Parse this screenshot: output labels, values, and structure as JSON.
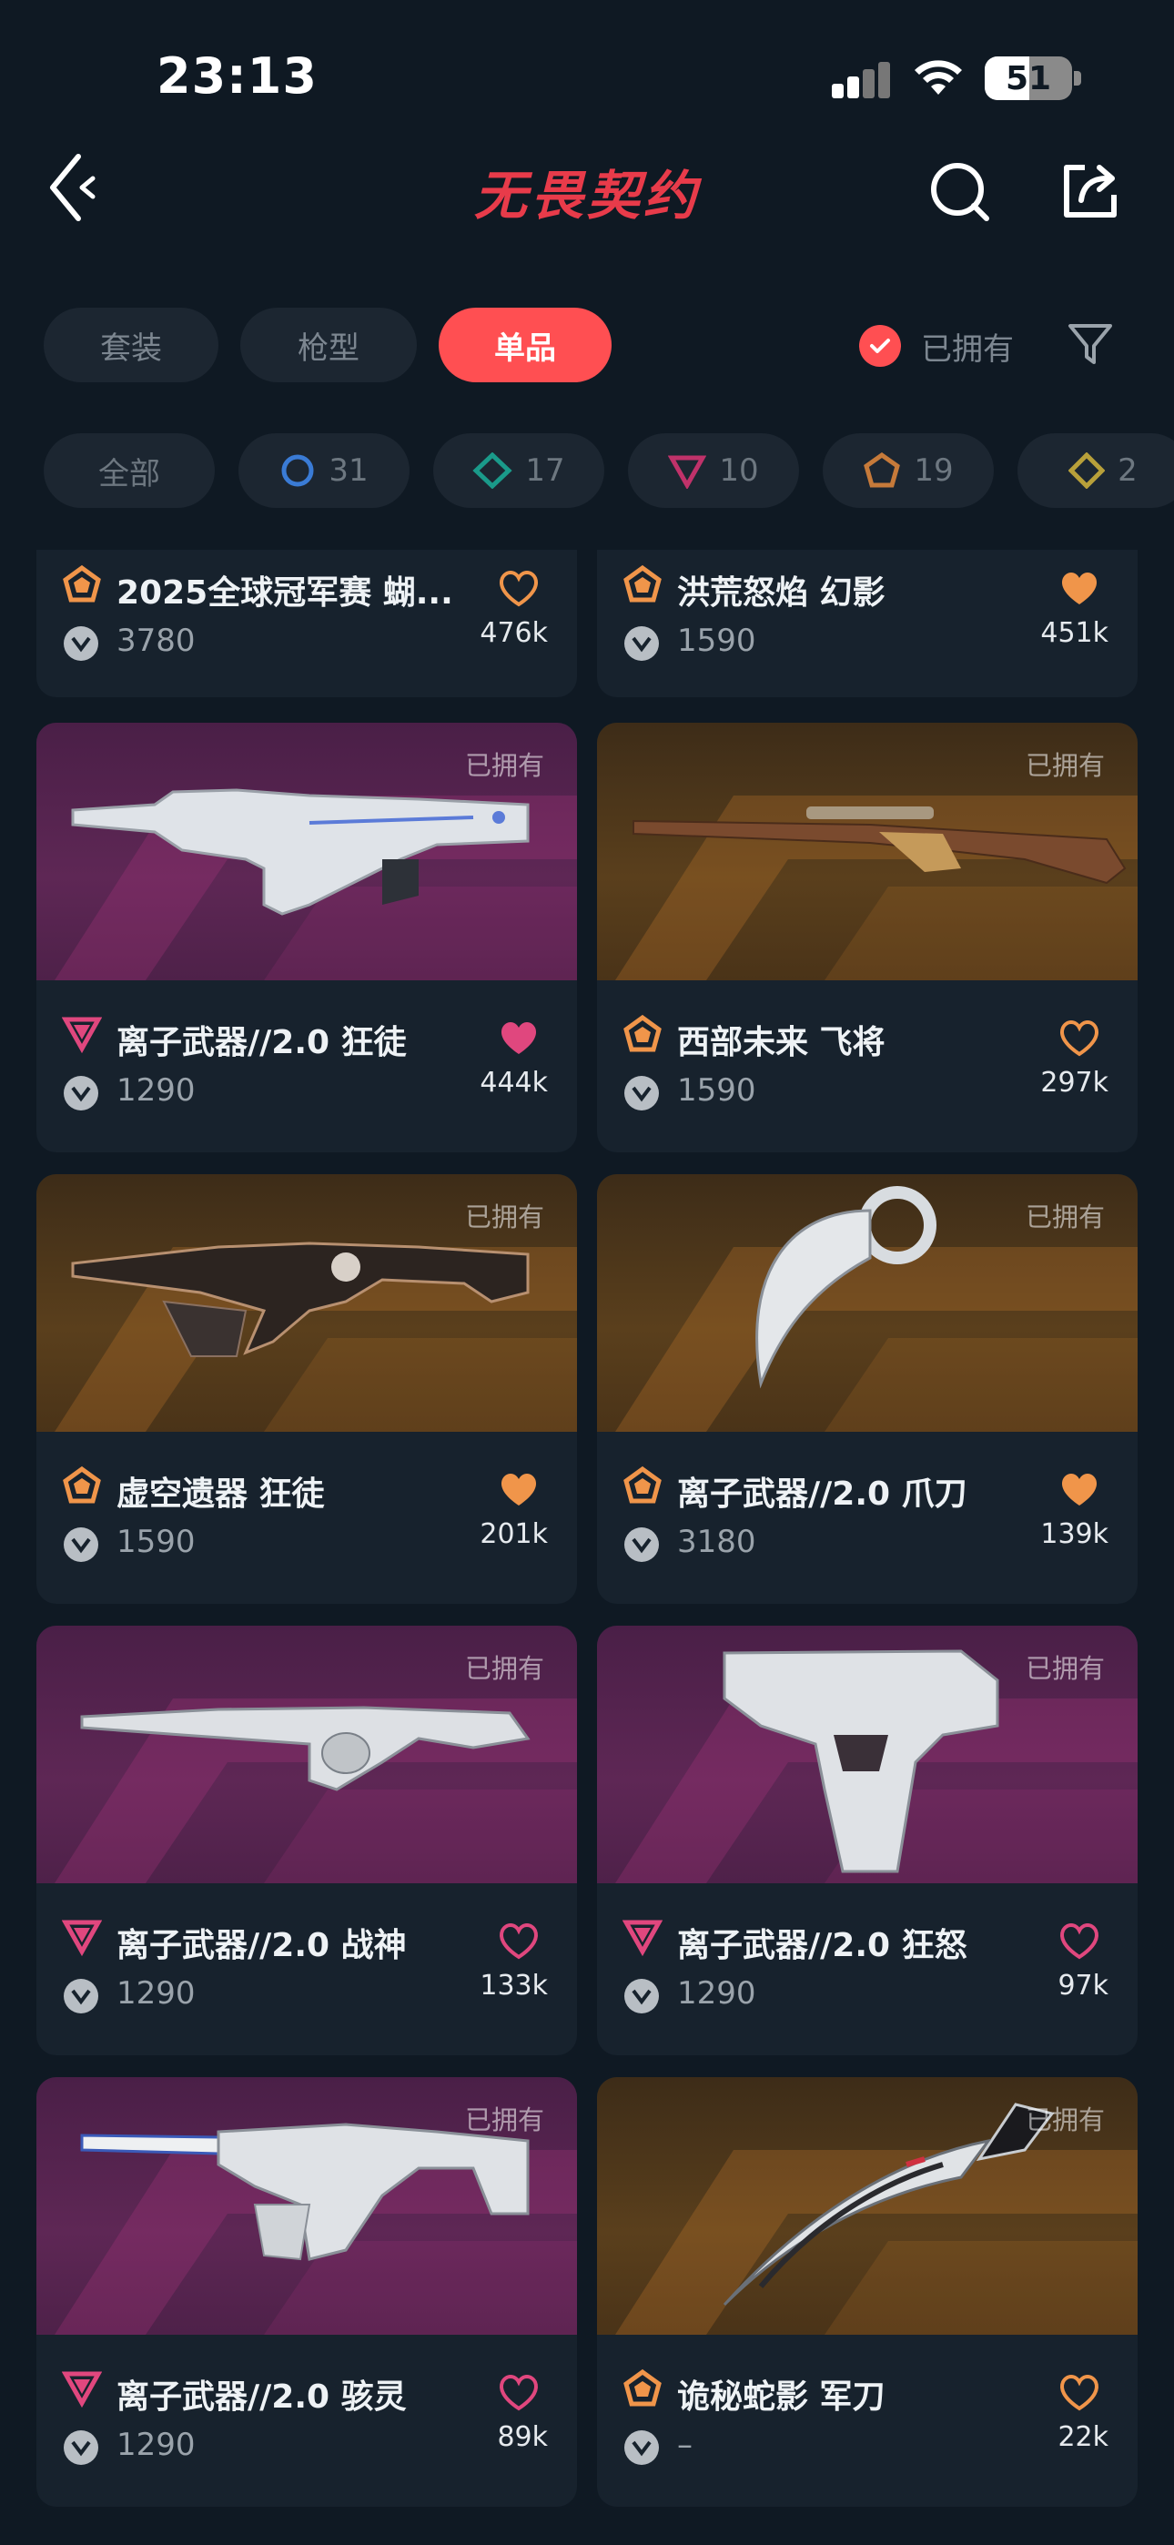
{
  "status_bar": {
    "time": "23:13",
    "battery": "51",
    "battery_level": 0.51
  },
  "header": {
    "title": "无畏契约",
    "back_icon": "chevron-left-icon",
    "search_icon": "search-icon",
    "share_icon": "share-icon"
  },
  "tabs": [
    {
      "label": "套装",
      "active": false
    },
    {
      "label": "枪型",
      "active": false
    },
    {
      "label": "单品",
      "active": true
    }
  ],
  "owned_filter": {
    "label": "已拥有",
    "checked": true,
    "filter_icon": "funnel-icon"
  },
  "tier_chips": [
    {
      "label": "全部",
      "icon": ""
    },
    {
      "count": "31",
      "icon": "select-tier-icon",
      "color": "#3a7bd5"
    },
    {
      "count": "17",
      "icon": "deluxe-tier-icon",
      "color": "#1a9a8a"
    },
    {
      "count": "10",
      "icon": "premium-tier-icon",
      "color": "#c0326a"
    },
    {
      "count": "19",
      "icon": "exclusive-tier-icon",
      "color": "#c67a3a"
    },
    {
      "count": "2",
      "icon": "ultra-tier-icon",
      "color": "#b8a03a"
    }
  ],
  "owned_tag": "已拥有",
  "items": [
    {
      "name": "2025全球冠军赛 蝴...",
      "price": "3780",
      "likes": "476k",
      "tier_color": "#f0954a",
      "liked": false,
      "heart_color": "#f0954a"
    },
    {
      "name": "洪荒怒焰 幻影",
      "price": "1590",
      "likes": "451k",
      "tier_color": "#f0954a",
      "liked": true,
      "heart_color": "#f0954a"
    },
    {
      "name": "离子武器//2.0 狂徒",
      "price": "1290",
      "likes": "444k",
      "tier_color": "#e0477e",
      "liked": true,
      "heart_color": "#e0477e",
      "bg": "purple",
      "owned": true
    },
    {
      "name": "西部未来 飞将",
      "price": "1590",
      "likes": "297k",
      "tier_color": "#f0954a",
      "liked": false,
      "heart_color": "#f0954a",
      "bg": "orange",
      "owned": true
    },
    {
      "name": "虚空遗器 狂徒",
      "price": "1590",
      "likes": "201k",
      "tier_color": "#f0954a",
      "liked": true,
      "heart_color": "#f0954a",
      "bg": "orange",
      "owned": true
    },
    {
      "name": "离子武器//2.0 爪刀",
      "price": "3180",
      "likes": "139k",
      "tier_color": "#f0954a",
      "liked": true,
      "heart_color": "#f0954a",
      "bg": "orange",
      "owned": true
    },
    {
      "name": "离子武器//2.0 战神",
      "price": "1290",
      "likes": "133k",
      "tier_color": "#e0477e",
      "liked": false,
      "heart_color": "#e0477e",
      "bg": "purple",
      "owned": true
    },
    {
      "name": "离子武器//2.0 狂怒",
      "price": "1290",
      "likes": "97k",
      "tier_color": "#e0477e",
      "liked": false,
      "heart_color": "#e0477e",
      "bg": "purple",
      "owned": true
    },
    {
      "name": "离子武器//2.0 骇灵",
      "price": "1290",
      "likes": "89k",
      "tier_color": "#e0477e",
      "liked": false,
      "heart_color": "#e0477e",
      "bg": "purple",
      "owned": true
    },
    {
      "name": "诡秘蛇影 军刀",
      "price": "–",
      "likes": "22k",
      "tier_color": "#f0954a",
      "liked": false,
      "heart_color": "#f0954a",
      "bg": "orange",
      "owned": true
    }
  ]
}
